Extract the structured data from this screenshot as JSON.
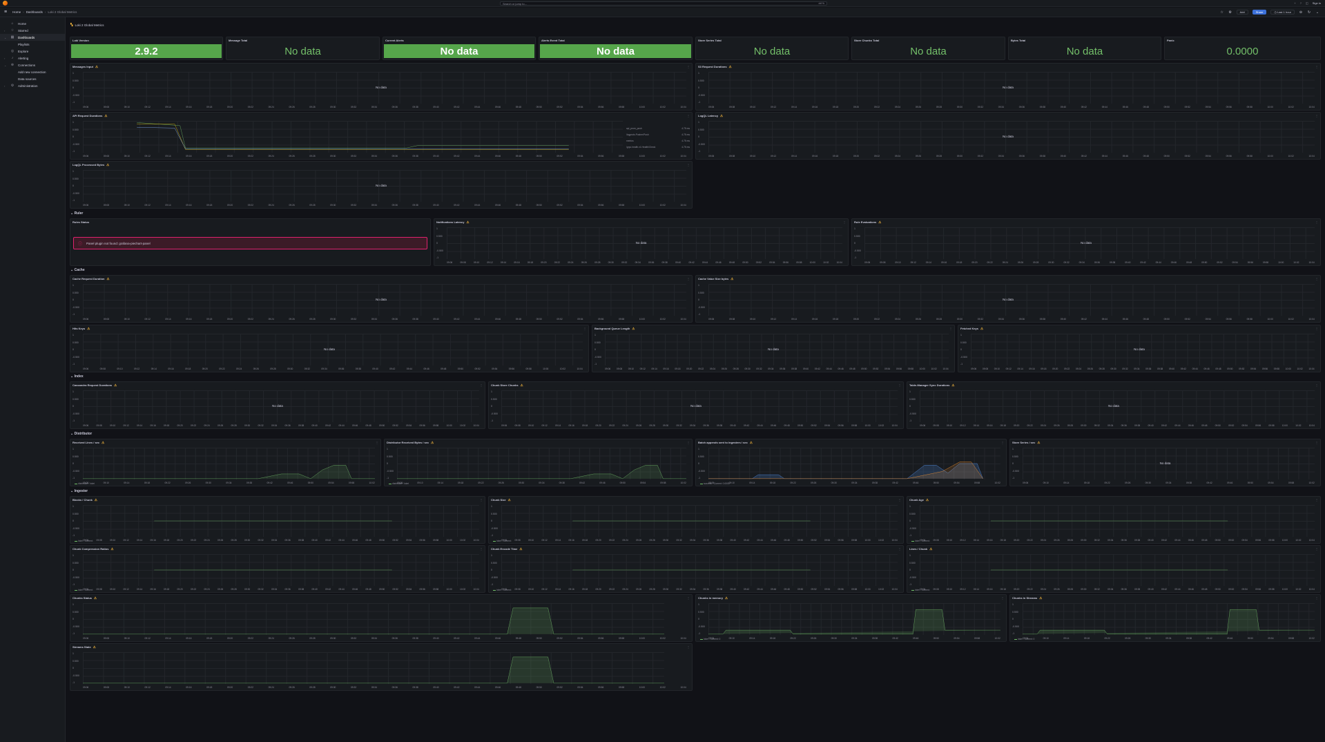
{
  "topbar": {
    "search_placeholder": "Search or jump to...",
    "search_shortcut": "ctrl+k",
    "sign_in": "Sign in"
  },
  "breadcrumbs": [
    "Home",
    "Dashboards",
    "Loki 2 Global Metrics"
  ],
  "toolbar": {
    "add": "Add",
    "share": "Share",
    "time_range": "Last 1 hour"
  },
  "sidebar": [
    {
      "label": "Home",
      "icon": "home-icon"
    },
    {
      "label": "Starred",
      "icon": "star-icon"
    },
    {
      "label": "Dashboards",
      "icon": "dashboards-icon",
      "active": true
    },
    {
      "label": "Playlists",
      "sub": true
    },
    {
      "label": "Explore",
      "icon": "compass-icon"
    },
    {
      "label": "Alerting",
      "icon": "bell-icon"
    },
    {
      "label": "Connections",
      "icon": "connections-icon"
    },
    {
      "label": "Add new connection",
      "sub": true
    },
    {
      "label": "Data sources",
      "sub": true
    },
    {
      "label": "Administration",
      "icon": "gear-icon"
    }
  ],
  "dashboard_title": "Loki 2 Global Metrics",
  "stats": [
    {
      "title": "Loki Version",
      "value": "2.9.2",
      "green": true
    },
    {
      "title": "Message Total",
      "value": "No data"
    },
    {
      "title": "Current Alerts",
      "value": "No data",
      "green": true
    },
    {
      "title": "Alerts Event Total",
      "value": "No data",
      "green": true
    },
    {
      "title": "Store Series Total",
      "value": "No data"
    },
    {
      "title": "Store Chunks Total",
      "value": "No data"
    },
    {
      "title": "Bytes Total",
      "value": "No data"
    },
    {
      "title": "Panic",
      "value": "0.0000"
    }
  ],
  "panels": {
    "messages_input": "Messages Input",
    "s3_request_durations": "S3 Request Durations",
    "api_request_durations": "API Request Durations",
    "logql_latency": "LogQL Latency",
    "logql_processed_bytes": "LogQL Processed Bytes",
    "rules_status": "Rules Status",
    "notifications_latency": "Notifications Latency",
    "rule_evaluations": "Rule Evaluations",
    "cache_request_duration": "Cache Request Duration",
    "cache_value_size_bytes": "Cache Value Size bytes",
    "hits_keys": "Hits Keys",
    "background_queue_length": "Background Queue Length",
    "fetched_keys": "Fetched Keys",
    "cassandra_request_durations": "Cassandra Request Durations",
    "chunk_store_chunks": "Chunk Store Chunks",
    "table_manager_sync_durations": "Table-Manager Sync Durations",
    "received_lines": "Received Lines / sec",
    "distributor_received_bytes": "Distributor Received Bytes / sec",
    "batch_appends": "Batch appends sent to ingesters / sec",
    "store_series": "Store Series / sec",
    "blocks_chunk": "Blocks / Chunk",
    "chunk_size": "Chunk Size",
    "chunk_age": "Chunk Age",
    "chunk_compression_ratios": "Chunk Compression Ratios",
    "chunk_encode_time": "Chunk Encode Time",
    "lines_chunk": "Lines / Chunk",
    "chunks_status": "Chunks Status",
    "chunks_in_memory": "Chunks in memory",
    "chunks_in_streams": "Chunks in Streams",
    "streams_state": "Streams State"
  },
  "no_data": "No data",
  "panel_error": "Panel plugin not found: grafana-piechart-panel",
  "rows": {
    "ruler": "Ruler",
    "cache": "Cache",
    "index": "Index",
    "distributor": "Distributor",
    "ingester": "Ingester"
  },
  "x_ticks": [
    "09:06",
    "09:08",
    "09:10",
    "09:12",
    "09:14",
    "09:16",
    "09:18",
    "09:20",
    "09:22",
    "09:24",
    "09:26",
    "09:28",
    "09:30",
    "09:32",
    "09:34",
    "09:36",
    "09:38",
    "09:40",
    "09:42",
    "09:44",
    "09:46",
    "09:48",
    "09:50",
    "09:52",
    "09:54",
    "09:56",
    "09:58",
    "10:00",
    "10:02",
    "10:04"
  ],
  "api_legend": [
    {
      "name": "api_prom_push",
      "value": "4.75 ms"
    },
    {
      "name": "/logproto.Pusher/Push",
      "value": "4.75 ms"
    },
    {
      "name": "metrics",
      "value": "4.75 ms"
    },
    {
      "name": "/grpc.health.v1.Health/Check",
      "value": "4.75 ms"
    }
  ],
  "legends": {
    "received_lines": "distributor / lokei",
    "received_bytes": "distributor / lokei",
    "batch_appends": [
      "success - Current: 0.0000",
      "success - Current: 0.0000",
      "success - Current: 0.0000"
    ],
    "blocks_chunk": "lokei - Current:",
    "chunk_size": "lokei - Current:",
    "chunk_age": "lokei - Current:",
    "compression": "lokei - Current:",
    "encode": "lokei - Current:",
    "lines": "lokei - Current:",
    "chunks_in_memory": "lokei - Current: 0",
    "chunks_in_streams": "lokei - Current: 0"
  },
  "y_ticks_generic": [
    "1",
    "0.500",
    "0",
    "-0.500",
    "-1"
  ]
}
